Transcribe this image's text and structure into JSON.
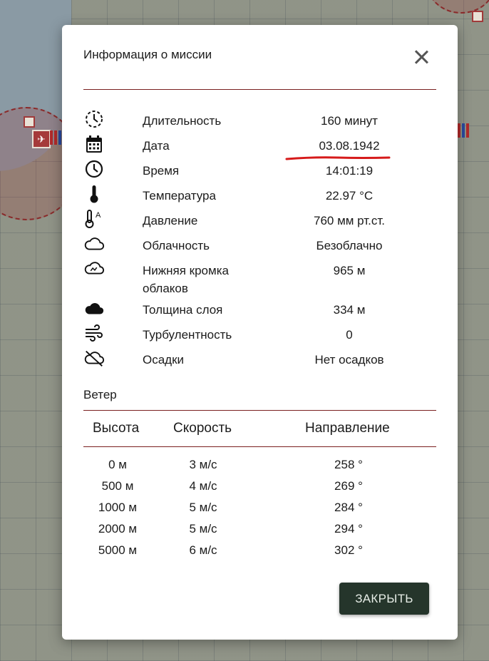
{
  "modal": {
    "title": "Информация о миссии",
    "close_button_label": "ЗАКРЫТЬ",
    "accent_color": "#7a1f1f",
    "button_color": "#25352b"
  },
  "mission_info": [
    {
      "icon": "clock-dashed-icon",
      "label": "Длительность",
      "value": "160 минут"
    },
    {
      "icon": "calendar-icon",
      "label": "Дата",
      "value": "03.08.1942",
      "highlight": true
    },
    {
      "icon": "clock-icon",
      "label": "Время",
      "value": "14:01:19"
    },
    {
      "icon": "thermometer-icon",
      "label": "Температура",
      "value": "22.97 °C"
    },
    {
      "icon": "pressure-icon",
      "label": "Давление",
      "value": "760 мм рт.ст."
    },
    {
      "icon": "cloud-outline-icon",
      "label": "Облачность",
      "value": "Безоблачно"
    },
    {
      "icon": "cloud-base-icon",
      "label": "Нижняя кромка облаков",
      "value": "965 м"
    },
    {
      "icon": "cloud-filled-icon",
      "label": "Толщина слоя",
      "value": "334 м"
    },
    {
      "icon": "wind-icon",
      "label": "Турбулентность",
      "value": "0"
    },
    {
      "icon": "no-precipitation-icon",
      "label": "Осадки",
      "value": "Нет осадков"
    }
  ],
  "wind": {
    "title": "Ветер",
    "headers": [
      "Высота",
      "Скорость",
      "Направление"
    ],
    "rows": [
      [
        "0 м",
        "3 м/с",
        "258 °"
      ],
      [
        "500 м",
        "4 м/с",
        "269 °"
      ],
      [
        "1000 м",
        "5 м/с",
        "284 °"
      ],
      [
        "2000 м",
        "5 м/с",
        "294 °"
      ],
      [
        "5000 м",
        "6 м/с",
        "302 °"
      ]
    ]
  }
}
